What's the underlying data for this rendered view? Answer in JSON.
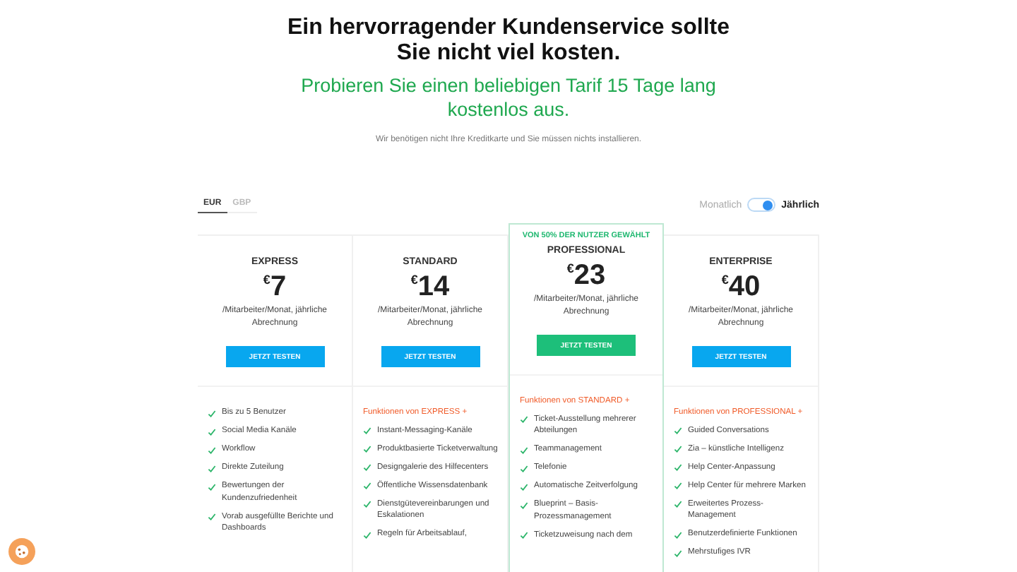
{
  "headline": "Ein hervorragender Kundenservice sollte Sie nicht viel kosten.",
  "subheadline": "Probieren Sie einen beliebigen Tarif 15 Tage lang kostenlos aus.",
  "note": "Wir benötigen nicht Ihre Kreditkarte und Sie müssen nichts installieren.",
  "currencies": [
    {
      "label": "EUR",
      "selected": true
    },
    {
      "label": "GBP",
      "selected": false
    }
  ],
  "billing": {
    "monthly_label": "Monatlich",
    "yearly_label": "Jährlich",
    "yearly": true
  },
  "plans": [
    {
      "name": "EXPRESS",
      "highlighted": false,
      "currency": "€",
      "price": "7",
      "unit": "/Mitarbeiter/Monat, jährliche Abrechnung",
      "button": "JETZT TESTEN",
      "features": [
        "Bis zu 5 Benutzer",
        "Social Media Kanäle",
        "Workflow",
        "Direkte Zuteilung",
        "Bewertungen der Kundenzufriedenheit",
        "Vorab ausgefüllte Berichte und Dashboards"
      ]
    },
    {
      "name": "STANDARD",
      "highlighted": false,
      "currency": "€",
      "price": "14",
      "unit": "/Mitarbeiter/Monat, jährliche Abrechnung",
      "button": "JETZT TESTEN",
      "features_heading": "Funktionen von EXPRESS +",
      "features": [
        "Instant-Messaging-Kanäle",
        "Produktbasierte Ticketverwaltung",
        "Designgalerie des Hilfecenters",
        "Öffentliche Wissensdatenbank",
        "Dienstgütevereinbarungen und Eskalationen",
        "Regeln für Arbeitsablauf,"
      ]
    },
    {
      "name": "PROFESSIONAL",
      "highlighted": true,
      "badge": "VON 50% DER NUTZER GEWÄHLT",
      "currency": "€",
      "price": "23",
      "unit": "/Mitarbeiter/Monat, jährliche Abrechnung",
      "button": "JETZT TESTEN",
      "features_heading": "Funktionen von STANDARD +",
      "features": [
        "Ticket-Ausstellung mehrerer Abteilungen",
        "Teammanagement",
        "Telefonie",
        "Automatische Zeitverfolgung",
        "Blueprint – Basis-Prozessmanagement",
        "Ticketzuweisung nach dem"
      ]
    },
    {
      "name": "ENTERPRISE",
      "highlighted": false,
      "currency": "€",
      "price": "40",
      "unit": "/Mitarbeiter/Monat, jährliche Abrechnung",
      "button": "JETZT TESTEN",
      "features_heading": "Funktionen von PROFESSIONAL +",
      "features": [
        "Guided Conversations",
        "Zia – künstliche Intelligenz",
        "Help Center-Anpassung",
        "Help Center für mehrere Marken",
        "Erweitertes Prozess-Management",
        "Benutzerdefinierte Funktionen",
        "Mehrstufiges IVR"
      ]
    }
  ]
}
